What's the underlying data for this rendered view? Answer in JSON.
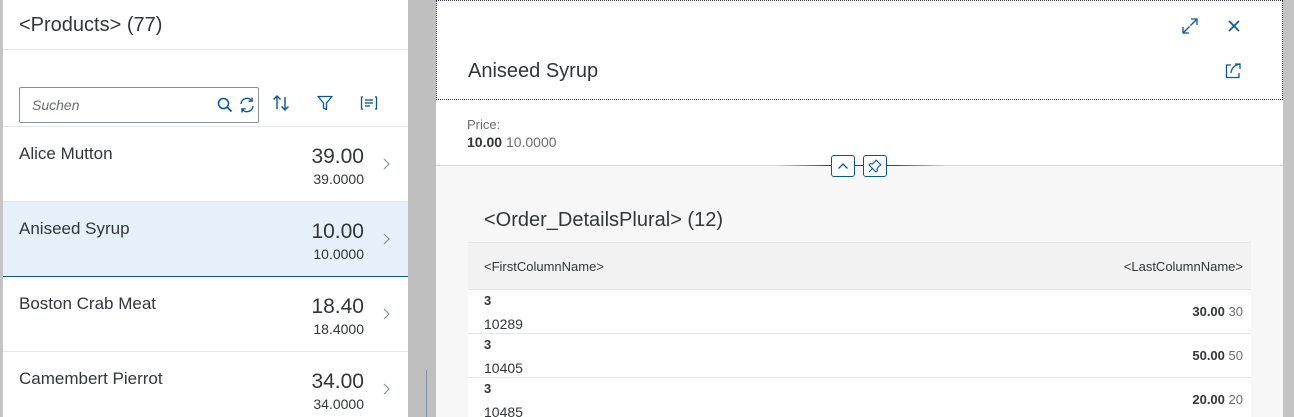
{
  "master": {
    "title": "<Products> (77)",
    "search": {
      "placeholder": "Suchen"
    },
    "icons": [
      "search-icon",
      "refresh-icon",
      "sort-icon",
      "filter-icon",
      "group-icon"
    ],
    "items": [
      {
        "name": "Alice Mutton",
        "number": "39.00",
        "sub": "39.0000",
        "selected": false
      },
      {
        "name": "Aniseed Syrup",
        "number": "10.00",
        "sub": "10.0000",
        "selected": true
      },
      {
        "name": "Boston Crab Meat",
        "number": "18.40",
        "sub": "18.4000",
        "selected": false
      },
      {
        "name": "Camembert Pierrot",
        "number": "34.00",
        "sub": "34.0000",
        "selected": false
      }
    ]
  },
  "detail": {
    "title": "Aniseed Syrup",
    "icons": [
      "fullscreen-icon",
      "close-icon",
      "share-icon",
      "collapse-header-icon",
      "pin-icon"
    ],
    "price": {
      "label": "Price:",
      "value": "10.00",
      "unit": "10.0000"
    },
    "table": {
      "title": "<Order_DetailsPlural> (12)",
      "first_column": "<FirstColumnName>",
      "last_column": "<LastColumnName>",
      "rows": [
        {
          "qty": "3",
          "order": "10289",
          "price": "30.00",
          "price_sub": "30"
        },
        {
          "qty": "3",
          "order": "10405",
          "price": "50.00",
          "price_sub": "50"
        },
        {
          "qty": "3",
          "order": "10485",
          "price": "20.00",
          "price_sub": "20"
        }
      ]
    }
  },
  "colors": {
    "accent": "#0854a0",
    "selected_bg": "#e5f0fa",
    "text": "#32363a",
    "muted": "#6a6d70"
  }
}
